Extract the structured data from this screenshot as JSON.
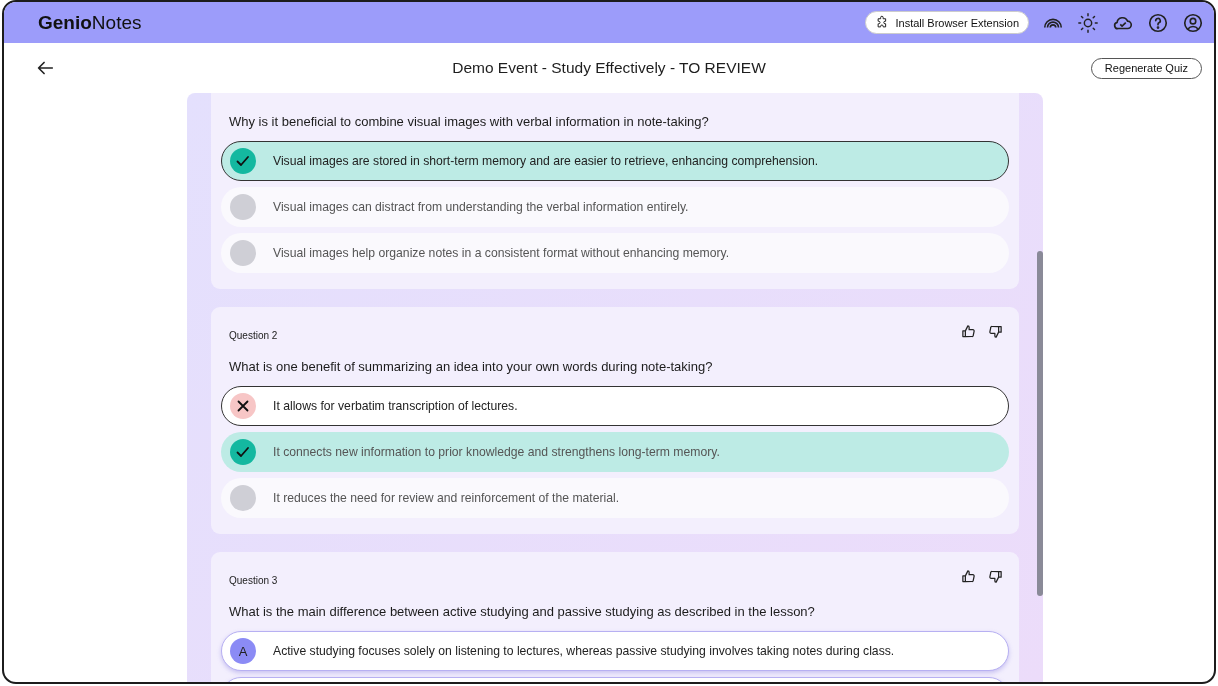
{
  "header": {
    "logo": "**Genio**Notes",
    "extension_button": "Install Browser Extension"
  },
  "title_bar": {
    "title": "Demo Event - Study Effectively - TO REVIEW",
    "regenerate_button": "Regenerate Quiz"
  },
  "questions": [
    {
      "question": "Why is it beneficial to combine visual images with verbal information in note-taking?",
      "options": [
        {
          "kind": "correct",
          "selected": true,
          "text": "Visual images are stored in short-term memory and are easier to retrieve, enhancing comprehension."
        },
        {
          "kind": "neutral",
          "selected": false,
          "text": "Visual images can distract from understanding the verbal information entirely."
        },
        {
          "kind": "neutral",
          "selected": false,
          "text": "Visual images help organize notes in a consistent format without enhancing memory."
        }
      ]
    },
    {
      "label": "Question 2",
      "question": "What is one benefit of summarizing an idea into your own words during note-taking?",
      "options": [
        {
          "kind": "wrong",
          "selected": true,
          "text": "It allows for verbatim transcription of lectures."
        },
        {
          "kind": "correct",
          "selected": false,
          "text": "It connects new information to prior knowledge and strengthens long-term memory."
        },
        {
          "kind": "neutral",
          "selected": false,
          "text": "It reduces the need for review and reinforcement of the material."
        }
      ]
    },
    {
      "label": "Question 3",
      "question": "What is the main difference between active studying and passive studying as described in the lesson?",
      "options": [
        {
          "kind": "pending",
          "selected": false,
          "marker": "A",
          "text": "Active studying focuses solely on listening to lectures, whereas passive studying involves taking notes during class."
        },
        {
          "kind": "pending",
          "selected": false
        }
      ]
    }
  ]
}
